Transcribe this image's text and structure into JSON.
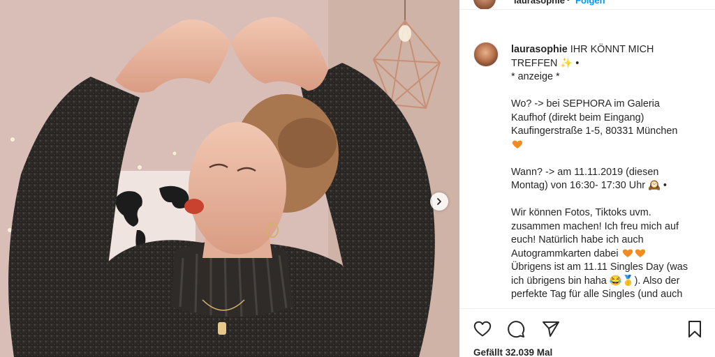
{
  "post": {
    "username": "laurasophie",
    "header_separator": "•",
    "follow_label": "Folgen",
    "caption": {
      "line1_text": "IHR KÖNNT MICH",
      "line2_text": "TREFFEN ✨ •",
      "line3_text": "* anzeige *",
      "line4_text": "Wo? -> bei SEPHORA im Galeria",
      "line5_text": "Kaufhof (direkt beim Eingang)",
      "line6_text": "Kaufingerstraße 1-5, 80331 München",
      "line8_text": "Wann? -> am 11.11.2019 (diesen",
      "line9_text": "Montag) von 16:30- 17:30 Uhr 🕰️ •",
      "line10_text": "Wir können Fotos, Tiktoks uvm.",
      "line11_text": "zusammen machen! Ich freu mich auf",
      "line12_text": "euch! Natürlich habe ich auch",
      "line13_text": "Autogrammkarten dabei",
      "line14_text": "Übrigens ist am 11.11 Singles Day (was",
      "line15_text": "ich übrigens bin haha 😂🥇). Also der",
      "line16_text": "perfekte Tag für alle Singles (und auch"
    },
    "likes_text": "Gefällt 32.039 Mal"
  },
  "icons": {
    "like": "heart-outline-icon",
    "comment": "comment-bubble-icon",
    "share": "paper-plane-icon",
    "save": "bookmark-icon",
    "next": "chevron-right-icon",
    "heart_emoji": "orange-heart-emoji"
  },
  "colors": {
    "text": "#262626",
    "link": "#0095f6",
    "heart_emoji": "#f58b1f",
    "divider": "#efefef"
  }
}
